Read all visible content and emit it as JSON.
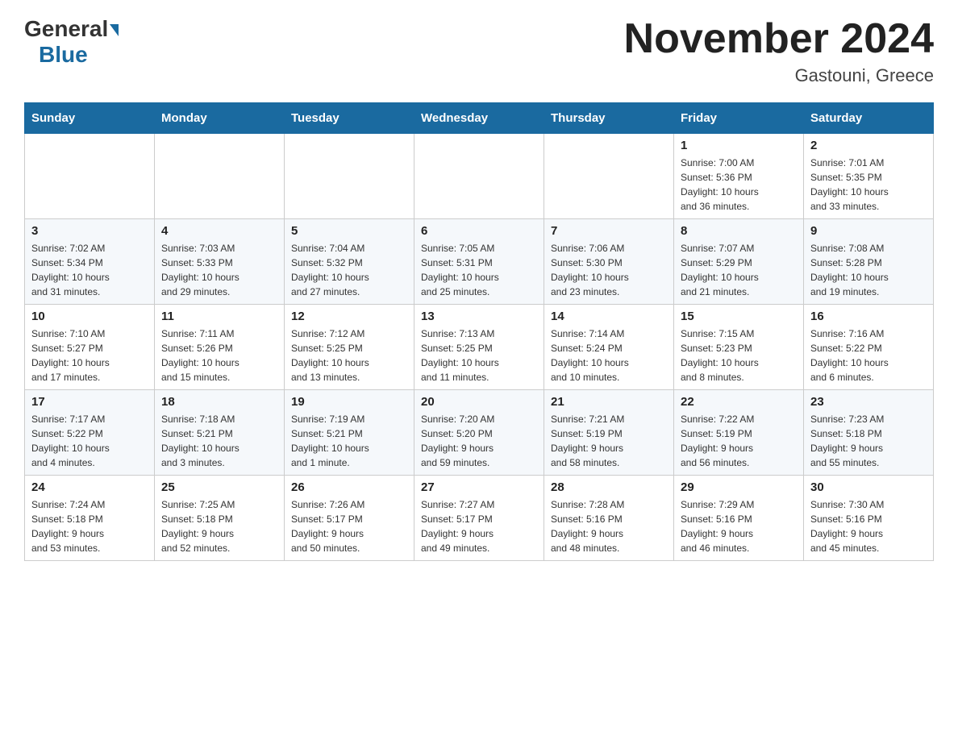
{
  "header": {
    "logo": {
      "general": "General",
      "triangle": "",
      "blue": "Blue"
    },
    "title": "November 2024",
    "location": "Gastouni, Greece"
  },
  "weekdays": [
    "Sunday",
    "Monday",
    "Tuesday",
    "Wednesday",
    "Thursday",
    "Friday",
    "Saturday"
  ],
  "weeks": [
    [
      {
        "day": "",
        "info": ""
      },
      {
        "day": "",
        "info": ""
      },
      {
        "day": "",
        "info": ""
      },
      {
        "day": "",
        "info": ""
      },
      {
        "day": "",
        "info": ""
      },
      {
        "day": "1",
        "info": "Sunrise: 7:00 AM\nSunset: 5:36 PM\nDaylight: 10 hours\nand 36 minutes."
      },
      {
        "day": "2",
        "info": "Sunrise: 7:01 AM\nSunset: 5:35 PM\nDaylight: 10 hours\nand 33 minutes."
      }
    ],
    [
      {
        "day": "3",
        "info": "Sunrise: 7:02 AM\nSunset: 5:34 PM\nDaylight: 10 hours\nand 31 minutes."
      },
      {
        "day": "4",
        "info": "Sunrise: 7:03 AM\nSunset: 5:33 PM\nDaylight: 10 hours\nand 29 minutes."
      },
      {
        "day": "5",
        "info": "Sunrise: 7:04 AM\nSunset: 5:32 PM\nDaylight: 10 hours\nand 27 minutes."
      },
      {
        "day": "6",
        "info": "Sunrise: 7:05 AM\nSunset: 5:31 PM\nDaylight: 10 hours\nand 25 minutes."
      },
      {
        "day": "7",
        "info": "Sunrise: 7:06 AM\nSunset: 5:30 PM\nDaylight: 10 hours\nand 23 minutes."
      },
      {
        "day": "8",
        "info": "Sunrise: 7:07 AM\nSunset: 5:29 PM\nDaylight: 10 hours\nand 21 minutes."
      },
      {
        "day": "9",
        "info": "Sunrise: 7:08 AM\nSunset: 5:28 PM\nDaylight: 10 hours\nand 19 minutes."
      }
    ],
    [
      {
        "day": "10",
        "info": "Sunrise: 7:10 AM\nSunset: 5:27 PM\nDaylight: 10 hours\nand 17 minutes."
      },
      {
        "day": "11",
        "info": "Sunrise: 7:11 AM\nSunset: 5:26 PM\nDaylight: 10 hours\nand 15 minutes."
      },
      {
        "day": "12",
        "info": "Sunrise: 7:12 AM\nSunset: 5:25 PM\nDaylight: 10 hours\nand 13 minutes."
      },
      {
        "day": "13",
        "info": "Sunrise: 7:13 AM\nSunset: 5:25 PM\nDaylight: 10 hours\nand 11 minutes."
      },
      {
        "day": "14",
        "info": "Sunrise: 7:14 AM\nSunset: 5:24 PM\nDaylight: 10 hours\nand 10 minutes."
      },
      {
        "day": "15",
        "info": "Sunrise: 7:15 AM\nSunset: 5:23 PM\nDaylight: 10 hours\nand 8 minutes."
      },
      {
        "day": "16",
        "info": "Sunrise: 7:16 AM\nSunset: 5:22 PM\nDaylight: 10 hours\nand 6 minutes."
      }
    ],
    [
      {
        "day": "17",
        "info": "Sunrise: 7:17 AM\nSunset: 5:22 PM\nDaylight: 10 hours\nand 4 minutes."
      },
      {
        "day": "18",
        "info": "Sunrise: 7:18 AM\nSunset: 5:21 PM\nDaylight: 10 hours\nand 3 minutes."
      },
      {
        "day": "19",
        "info": "Sunrise: 7:19 AM\nSunset: 5:21 PM\nDaylight: 10 hours\nand 1 minute."
      },
      {
        "day": "20",
        "info": "Sunrise: 7:20 AM\nSunset: 5:20 PM\nDaylight: 9 hours\nand 59 minutes."
      },
      {
        "day": "21",
        "info": "Sunrise: 7:21 AM\nSunset: 5:19 PM\nDaylight: 9 hours\nand 58 minutes."
      },
      {
        "day": "22",
        "info": "Sunrise: 7:22 AM\nSunset: 5:19 PM\nDaylight: 9 hours\nand 56 minutes."
      },
      {
        "day": "23",
        "info": "Sunrise: 7:23 AM\nSunset: 5:18 PM\nDaylight: 9 hours\nand 55 minutes."
      }
    ],
    [
      {
        "day": "24",
        "info": "Sunrise: 7:24 AM\nSunset: 5:18 PM\nDaylight: 9 hours\nand 53 minutes."
      },
      {
        "day": "25",
        "info": "Sunrise: 7:25 AM\nSunset: 5:18 PM\nDaylight: 9 hours\nand 52 minutes."
      },
      {
        "day": "26",
        "info": "Sunrise: 7:26 AM\nSunset: 5:17 PM\nDaylight: 9 hours\nand 50 minutes."
      },
      {
        "day": "27",
        "info": "Sunrise: 7:27 AM\nSunset: 5:17 PM\nDaylight: 9 hours\nand 49 minutes."
      },
      {
        "day": "28",
        "info": "Sunrise: 7:28 AM\nSunset: 5:16 PM\nDaylight: 9 hours\nand 48 minutes."
      },
      {
        "day": "29",
        "info": "Sunrise: 7:29 AM\nSunset: 5:16 PM\nDaylight: 9 hours\nand 46 minutes."
      },
      {
        "day": "30",
        "info": "Sunrise: 7:30 AM\nSunset: 5:16 PM\nDaylight: 9 hours\nand 45 minutes."
      }
    ]
  ]
}
